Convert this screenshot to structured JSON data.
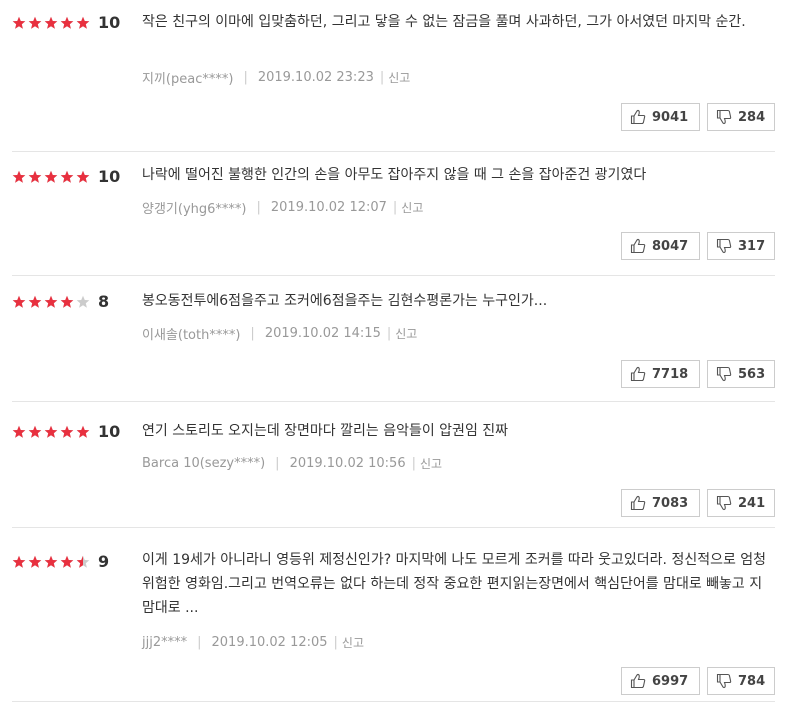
{
  "reviews": [
    {
      "score": "10",
      "stars": 5,
      "text": "작은 친구의 이마에 입맞춤하던, 그리고 닿을 수 없는 잠금을 풀며 사과하던, 그가 아서였던 마지막 순간.",
      "nick": "지끼(peac****)",
      "date": "2019.10.02 23:23",
      "report": "신고",
      "likes": "9041",
      "dislikes": "284"
    },
    {
      "score": "10",
      "stars": 5,
      "text": "나락에 떨어진 불행한 인간의 손을 아무도 잡아주지 않을 때 그 손을 잡아준건 광기였다",
      "nick": "양갱기(yhg6****)",
      "date": "2019.10.02 12:07",
      "report": "신고",
      "likes": "8047",
      "dislikes": "317"
    },
    {
      "score": "8",
      "stars": 4,
      "text": "봉오동전투에6점을주고 조커에6점을주는 김현수평론가는 누구인가...",
      "nick": "이새솔(toth****)",
      "date": "2019.10.02 14:15",
      "report": "신고",
      "likes": "7718",
      "dislikes": "563"
    },
    {
      "score": "10",
      "stars": 5,
      "text": "연기 스토리도 오지는데 장면마다 깔리는 음악들이 압권임 진짜",
      "nick": "Barca 10(sezy****)",
      "date": "2019.10.02 10:56",
      "report": "신고",
      "likes": "7083",
      "dislikes": "241"
    },
    {
      "score": "9",
      "stars": 4.5,
      "text": "이게 19세가 아니라니 영등위 제정신인가? 마지막에 나도 모르게 조커를 따라 웃고있더라. 정신적으로 엄청 위험한 영화임.그리고 번역오류는 없다 하는데 정작 중요한 편지읽는장면에서 핵심단어를 맘대로 빼놓고 지 맘대로 ...",
      "nick": "jjj2****",
      "date": "2019.10.02 12:05",
      "report": "신고",
      "likes": "6997",
      "dislikes": "784"
    }
  ],
  "icons": {
    "star": "star-icon",
    "up": "thumbs-up-icon",
    "down": "thumbs-down-icon"
  },
  "colors": {
    "star_on": "#e8303f",
    "star_off": "#cccccc"
  }
}
